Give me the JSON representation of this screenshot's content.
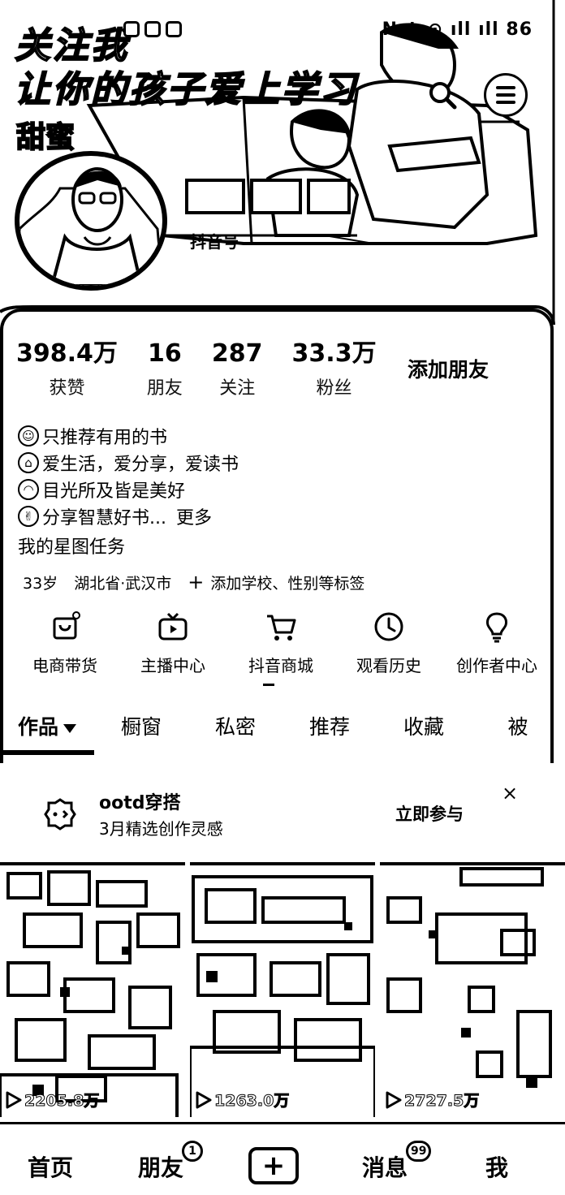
{
  "status_bar": {
    "right_text": "N ✱ ⊙ ıll ıll 86"
  },
  "banner": {
    "title_line1": "关注我",
    "title_line2": "让你的孩子爱上学习",
    "doodle": "甜蜜",
    "douyin_id": "抖音号"
  },
  "stats": [
    {
      "value": "398.4万",
      "label": "获赞"
    },
    {
      "value": "16",
      "label": "朋友"
    },
    {
      "value": "287",
      "label": "关注"
    },
    {
      "value": "33.3万",
      "label": "粉丝"
    }
  ],
  "add_friend": "添加朋友",
  "bio": [
    {
      "emoji": "☺",
      "text": "只推荐有用的书"
    },
    {
      "emoji": "⌂",
      "text": "爱生活，爱分享，爱读书"
    },
    {
      "emoji": "◠",
      "text": "目光所及皆是美好"
    },
    {
      "emoji": "✌",
      "text": "分享智慧好书..."
    }
  ],
  "bio_more": "更多",
  "star_task": "我的星图任务",
  "tags": {
    "age": "33岁",
    "location": "湖北省·武汉市",
    "add": "添加学校、性别等标签"
  },
  "tools": [
    {
      "icon": "shopping-bag-icon",
      "label": "电商带货"
    },
    {
      "icon": "tv-play-icon",
      "label": "主播中心"
    },
    {
      "icon": "cart-icon",
      "label": "抖音商城"
    },
    {
      "icon": "clock-icon",
      "label": "观看历史"
    },
    {
      "icon": "lightbulb-icon",
      "label": "创作者中心"
    }
  ],
  "tabs": [
    "作品",
    "橱窗",
    "私密",
    "推荐",
    "收藏",
    "被"
  ],
  "promo": {
    "title": "ootd穿搭",
    "subtitle": "3月精选创作灵感",
    "join": "立即参与",
    "close": "×"
  },
  "videos": [
    {
      "plays": "2205.8万"
    },
    {
      "plays": "1263.0万"
    },
    {
      "plays": "2727.5万"
    }
  ],
  "bottom_nav": {
    "home": "首页",
    "friends": "朋友",
    "friends_badge": "1",
    "plus": "+",
    "messages": "消息",
    "messages_badge": "99",
    "me": "我"
  },
  "colors": {
    "primary": "#000000",
    "background": "#ffffff"
  }
}
